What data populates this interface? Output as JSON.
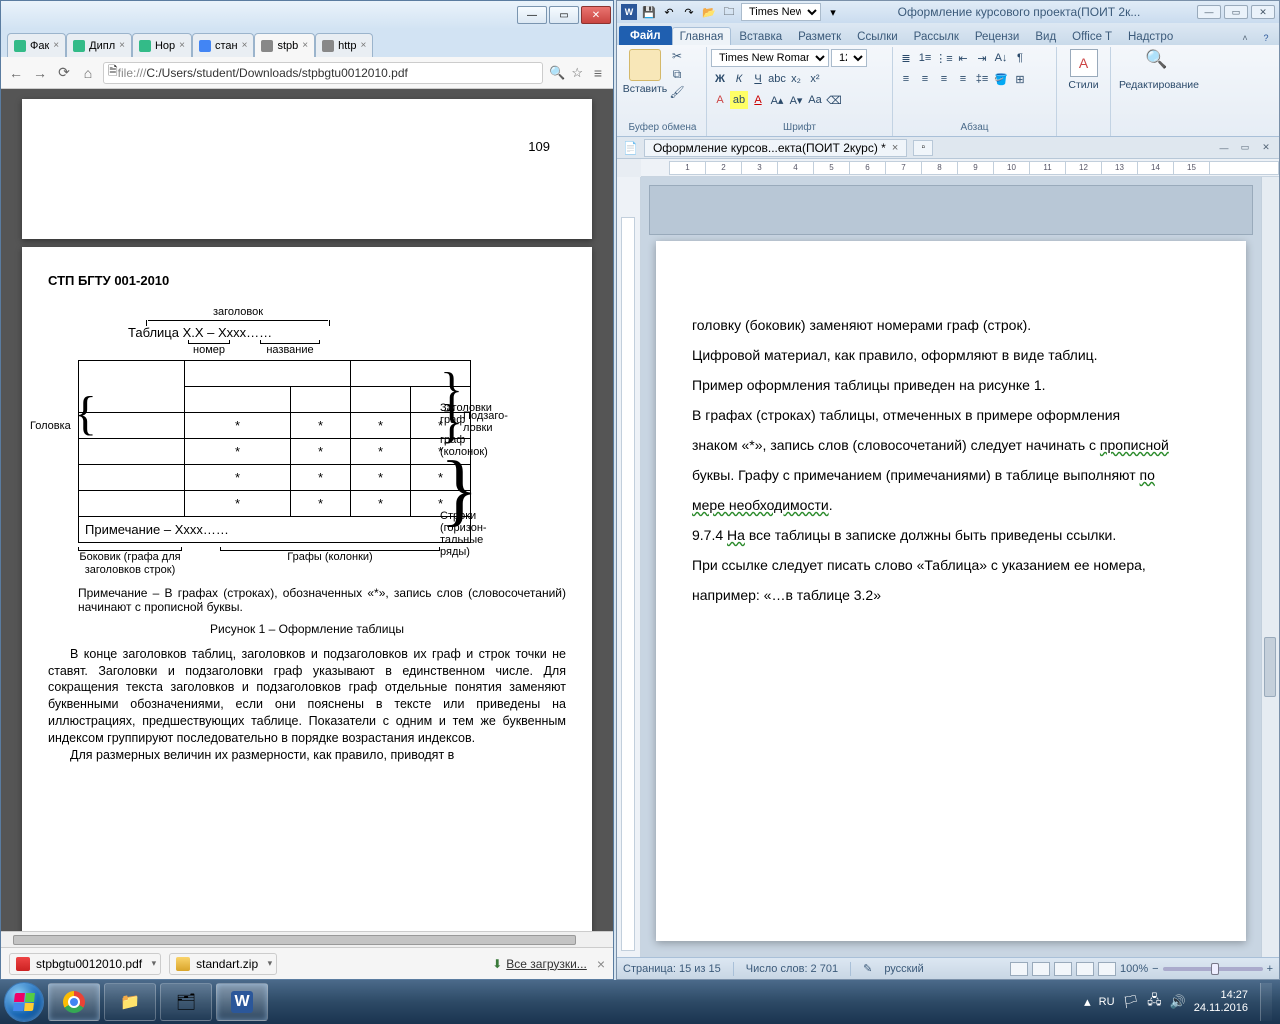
{
  "chrome": {
    "tabs": [
      {
        "label": "Фак",
        "fav": "t"
      },
      {
        "label": "Дипл",
        "fav": "t"
      },
      {
        "label": "Нор",
        "fav": "t"
      },
      {
        "label": "стан",
        "fav": "g"
      },
      {
        "label": "stpb",
        "fav": "pdf",
        "active": true
      },
      {
        "label": "http",
        "fav": "pdf"
      }
    ],
    "address_proto": "file:///",
    "address_path": "C:/Users/student/Downloads/stpbgtu0012010.pdf",
    "pdf": {
      "prev_page_num": "109",
      "heading": "СТП БГТУ 001-2010",
      "diag": {
        "zagolovok": "заголовок",
        "tablitsa": "Таблица Х.Х – Хххх……",
        "nomer": "номер",
        "nazvanie": "название",
        "golovka": "Головка",
        "zag_graf": "Заголовки граф",
        "podzag": "Подзаго-ловки граф (колонок)",
        "stroki": "Строки (горизон-тальные ряды)",
        "prim_row": "Примечание – Хххх……",
        "bokovik": "Боковик (графа для заголовков строк)",
        "grafy": "Графы (колонки)"
      },
      "note": "Примечание – В графах (строках), обозначенных «*», запись слов (словосочетаний) начинают с прописной буквы.",
      "caption": "Рисунок 1 – Оформление таблицы",
      "body1": "В конце заголовков таблиц, заголовков и подзаголовков их граф и строк точки не ставят. Заголовки и подзаголовки граф указывают в единственном числе. Для сокращения текста заголовков и подзаголовков граф отдельные понятия заменяют буквенными обозначениями, если они пояснены в тексте или приведены на иллюстрациях, предшествующих таблице. Показатели с одним и тем же буквенным индексом группируют последовательно в порядке возрастания индексов.",
      "body2": "Для размерных величин их размерности, как правило, приводят в"
    },
    "downloads": {
      "item1": "stpbgtu0012010.pdf",
      "item2": "standart.zip",
      "all": "Все загрузки..."
    }
  },
  "word": {
    "qat_font": "Times New Ro",
    "title": "Оформление курсового проекта(ПОИТ 2к...",
    "tabs": {
      "file": "Файл",
      "home": "Главная",
      "insert": "Вставка",
      "layout": "Разметк",
      "refs": "Ссылки",
      "mail": "Рассылк",
      "review": "Рецензи",
      "view": "Вид",
      "office": "Office T",
      "nadstr": "Надстро"
    },
    "ribbon": {
      "paste": "Вставить",
      "clipboard": "Буфер обмена",
      "font_name": "Times New Roman",
      "font_size": "12",
      "font_lbl": "Шрифт",
      "para_lbl": "Абзац",
      "styles": "Стили",
      "editing": "Редактирование"
    },
    "doc_tab": "Оформление курсов...екта(ПОИТ 2курс) *",
    "doc": {
      "p1a": "головку (боковик) заменяют номерами граф (строк).",
      "p2": "Цифровой материал, как правило, оформляют в виде таблиц.",
      "p3": "Пример оформления таблицы приведен на рисунке 1.",
      "p4": "В графах (строках) таблицы, отмеченных в примере оформления",
      "p5a": "знаком «*», запись слов (словосочетаний) следует начинать с ",
      "p5u": "прописной",
      "p6a": "буквы. Графу с примечанием (примечаниями) в таблице выполняют ",
      "p6u": "по",
      "p7a": "мере необходимости",
      "p7b": ".",
      "p8a": "9.7.4 ",
      "p8u": "На",
      "p8b": " все таблицы в записке должны быть приведены ссылки.",
      "p9": "При ссылке следует писать слово «Таблица» с указанием ее номера,",
      "p10": "например: «…в таблице 3.2»"
    },
    "status": {
      "page": "Страница: 15 из 15",
      "words": "Число слов: 2 701",
      "lang": "русский",
      "zoom": "100%"
    }
  },
  "taskbar": {
    "lang": "RU",
    "time": "14:27",
    "date": "24.11.2016"
  }
}
